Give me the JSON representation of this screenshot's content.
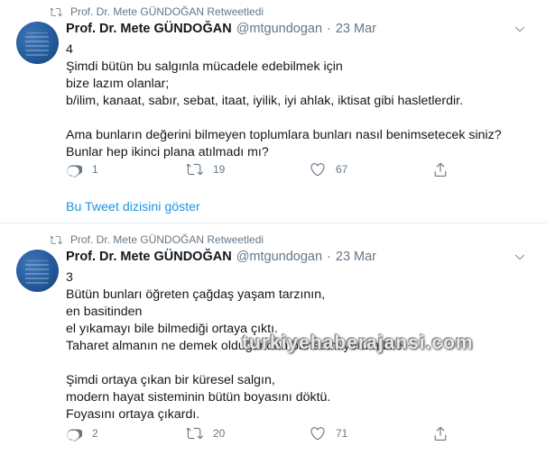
{
  "tweets": [
    {
      "retweet_label": "Prof. Dr. Mete GÜNDOĞAN Retweetledi",
      "name": "Prof. Dr. Mete GÜNDOĞAN",
      "handle": "@mtgundogan",
      "dot": "·",
      "date": "23 Mar",
      "lines": [
        "4",
        "Şimdi bütün bu salgınla mücadele edebilmek için",
        "bize lazım olanlar;",
        "b/ilim, kanaat, sabır, sebat, itaat, iyilik, iyi ahlak, iktisat gibi hasletlerdir.",
        "",
        "Ama bunların değerini bilmeyen toplumlara bunları nasıl benimsetecek siniz?",
        "Bunlar hep ikinci plana atılmadı mı?"
      ],
      "replies": "1",
      "retweets": "19",
      "likes": "67",
      "thread_link": "Bu Tweet dizisini göster"
    },
    {
      "retweet_label": "Prof. Dr. Mete GÜNDOĞAN Retweetledi",
      "name": "Prof. Dr. Mete GÜNDOĞAN",
      "handle": "@mtgundogan",
      "dot": "·",
      "date": "23 Mar",
      "lines": [
        "3",
        "Bütün bunları öğreten çağdaş yaşam tarzının,",
        "en basitinden",
        "el yıkamayı bile bilmediği ortaya çıktı.",
        "Taharet almanın ne demek olduğundan bahsetmiyorum bile.",
        "",
        "Şimdi ortaya çıkan bir küresel salgın,",
        "modern hayat sisteminin bütün boyasını döktü.",
        "Foyasını ortaya çıkardı."
      ],
      "replies": "2",
      "retweets": "20",
      "likes": "71"
    }
  ],
  "watermark": "turkiyehaberajansi.com",
  "icons": {
    "retweet": "retweet-icon",
    "reply": "reply-icon",
    "like": "heart-icon",
    "share": "share-icon",
    "caret": "chevron-down-icon"
  }
}
